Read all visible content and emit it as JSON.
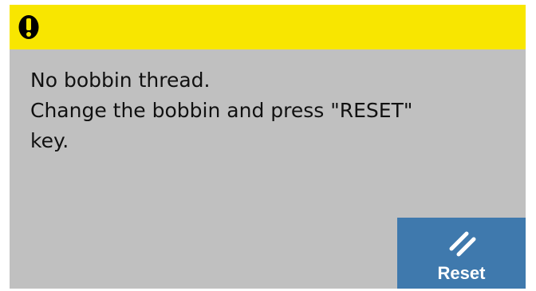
{
  "header": {
    "icon": "exclamation-warning-icon",
    "color": "#f8e600"
  },
  "message": {
    "lines": [
      "No bobbin thread.",
      "Change the bobbin and press \"RESET\"",
      "key."
    ]
  },
  "reset_button": {
    "label": "Reset",
    "icon": "reset-slashes-icon",
    "color": "#3f79ad"
  },
  "colors": {
    "panel_background": "#c0c0c0",
    "text": "#111111",
    "button_text": "#ffffff"
  }
}
